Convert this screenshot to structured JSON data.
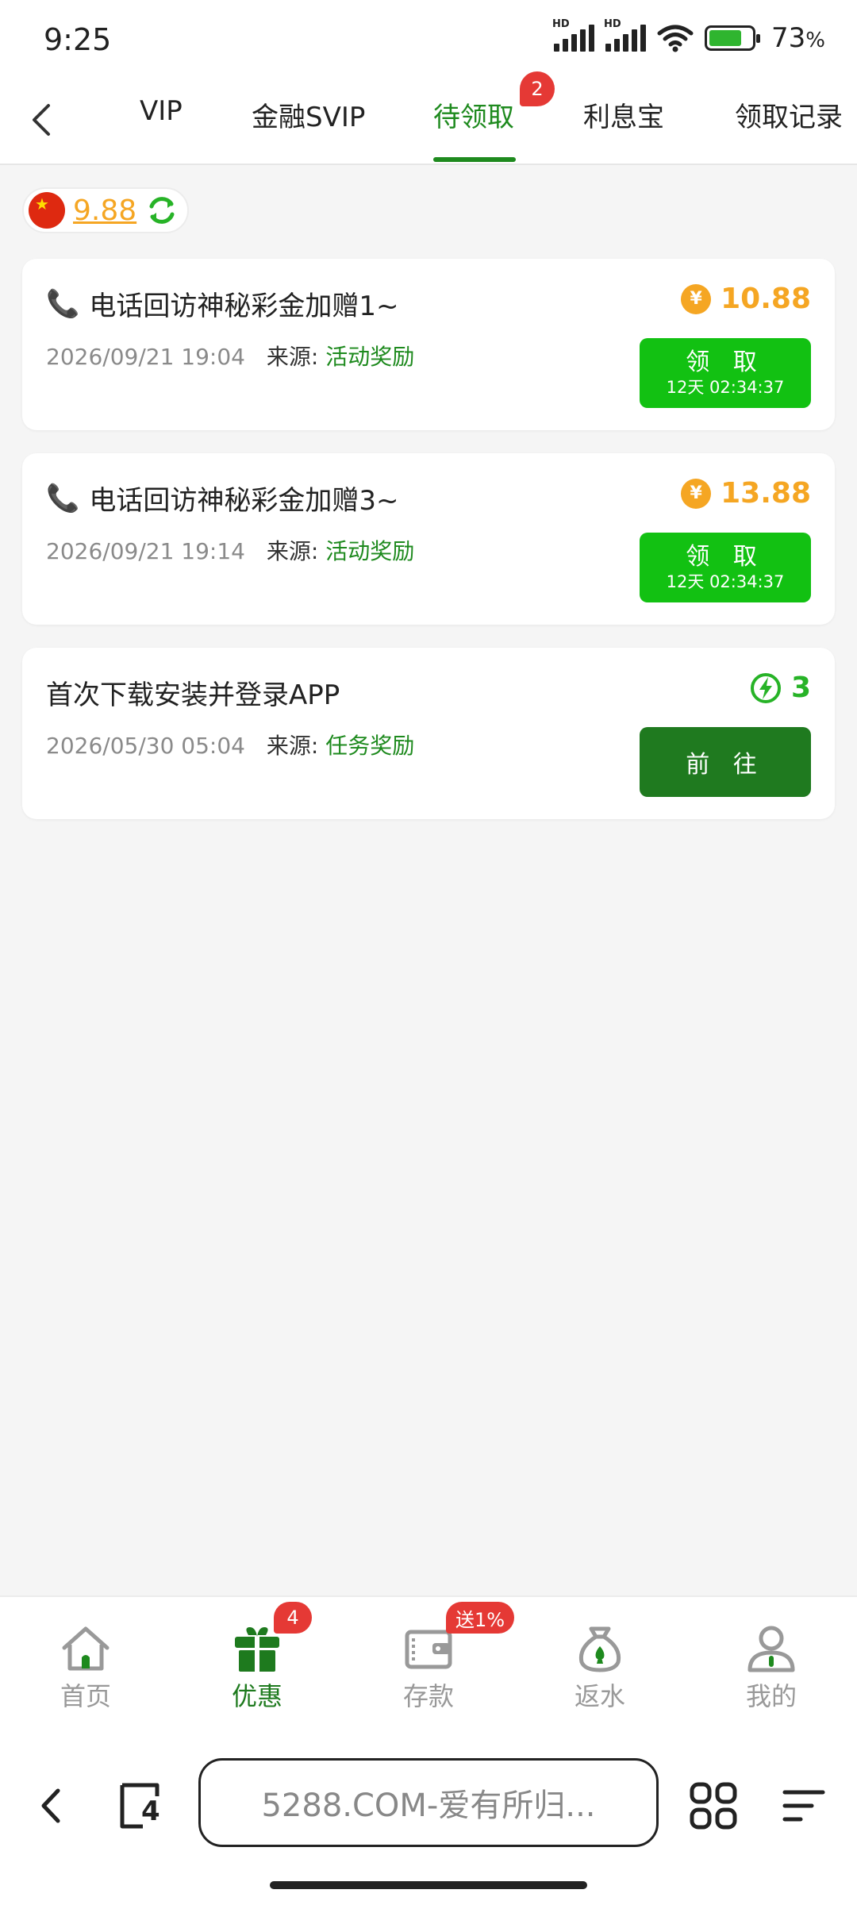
{
  "status_bar": {
    "time": "9:25",
    "battery_percent": "73",
    "battery_suffix": "%",
    "hd_label": "HD",
    "icons": [
      "hd-signal-icon",
      "hd-signal-icon",
      "wifi-icon",
      "battery-charging-icon"
    ]
  },
  "top_nav": {
    "back_icon": "chevron-left-icon",
    "tabs": [
      {
        "label": "VIP"
      },
      {
        "label": "金融SVIP"
      },
      {
        "label": "待领取",
        "badge": "2",
        "active": true
      },
      {
        "label": "利息宝"
      },
      {
        "label": "领取记录"
      }
    ],
    "accent_color": "#1e8a1e"
  },
  "balance": {
    "flag": "china-flag-icon",
    "amount": "9.88",
    "refresh_icon": "refresh-icon"
  },
  "cards": [
    {
      "title": "电话回访神秘彩金加赠1~",
      "icon": "phone-icon",
      "datetime": "2026/09/21 19:04",
      "source_label": "来源:",
      "source_value": "活动奖励",
      "amount_icon": "yuan-coin-icon",
      "coin_symbol": "¥",
      "amount": "10.88",
      "button_label": "领 取",
      "button_timer": "12天 02:34:37"
    },
    {
      "title": "电话回访神秘彩金加赠3~",
      "icon": "phone-icon",
      "datetime": "2026/09/21 19:14",
      "source_label": "来源:",
      "source_value": "活动奖励",
      "amount_icon": "yuan-coin-icon",
      "coin_symbol": "¥",
      "amount": "13.88",
      "button_label": "领 取",
      "button_timer": "12天 02:34:37"
    },
    {
      "title": "首次下载安装并登录APP",
      "datetime": "2026/05/30 05:04",
      "source_label": "来源:",
      "source_value": "任务奖励",
      "amount_icon": "lightning-icon",
      "amount": "3",
      "button_label": "前 往"
    }
  ],
  "bottom_nav": {
    "items": [
      {
        "label": "首页",
        "icon": "home-icon"
      },
      {
        "label": "优惠",
        "icon": "gift-icon",
        "badge": "4",
        "active": true
      },
      {
        "label": "存款",
        "icon": "wallet-icon",
        "badge": "送1%"
      },
      {
        "label": "返水",
        "icon": "money-bag-icon"
      },
      {
        "label": "我的",
        "icon": "user-icon"
      }
    ]
  },
  "browser_bar": {
    "url": "5288.COM-爱有所归...",
    "tab_count": "4",
    "icons": [
      "back-arrow-icon",
      "tabs-icon",
      "apps-grid-icon",
      "menu-icon"
    ]
  },
  "colors": {
    "green_primary": "#12c112",
    "green_dark": "#1f7a1f",
    "gold": "#f5a623",
    "badge_red": "#e53935"
  }
}
